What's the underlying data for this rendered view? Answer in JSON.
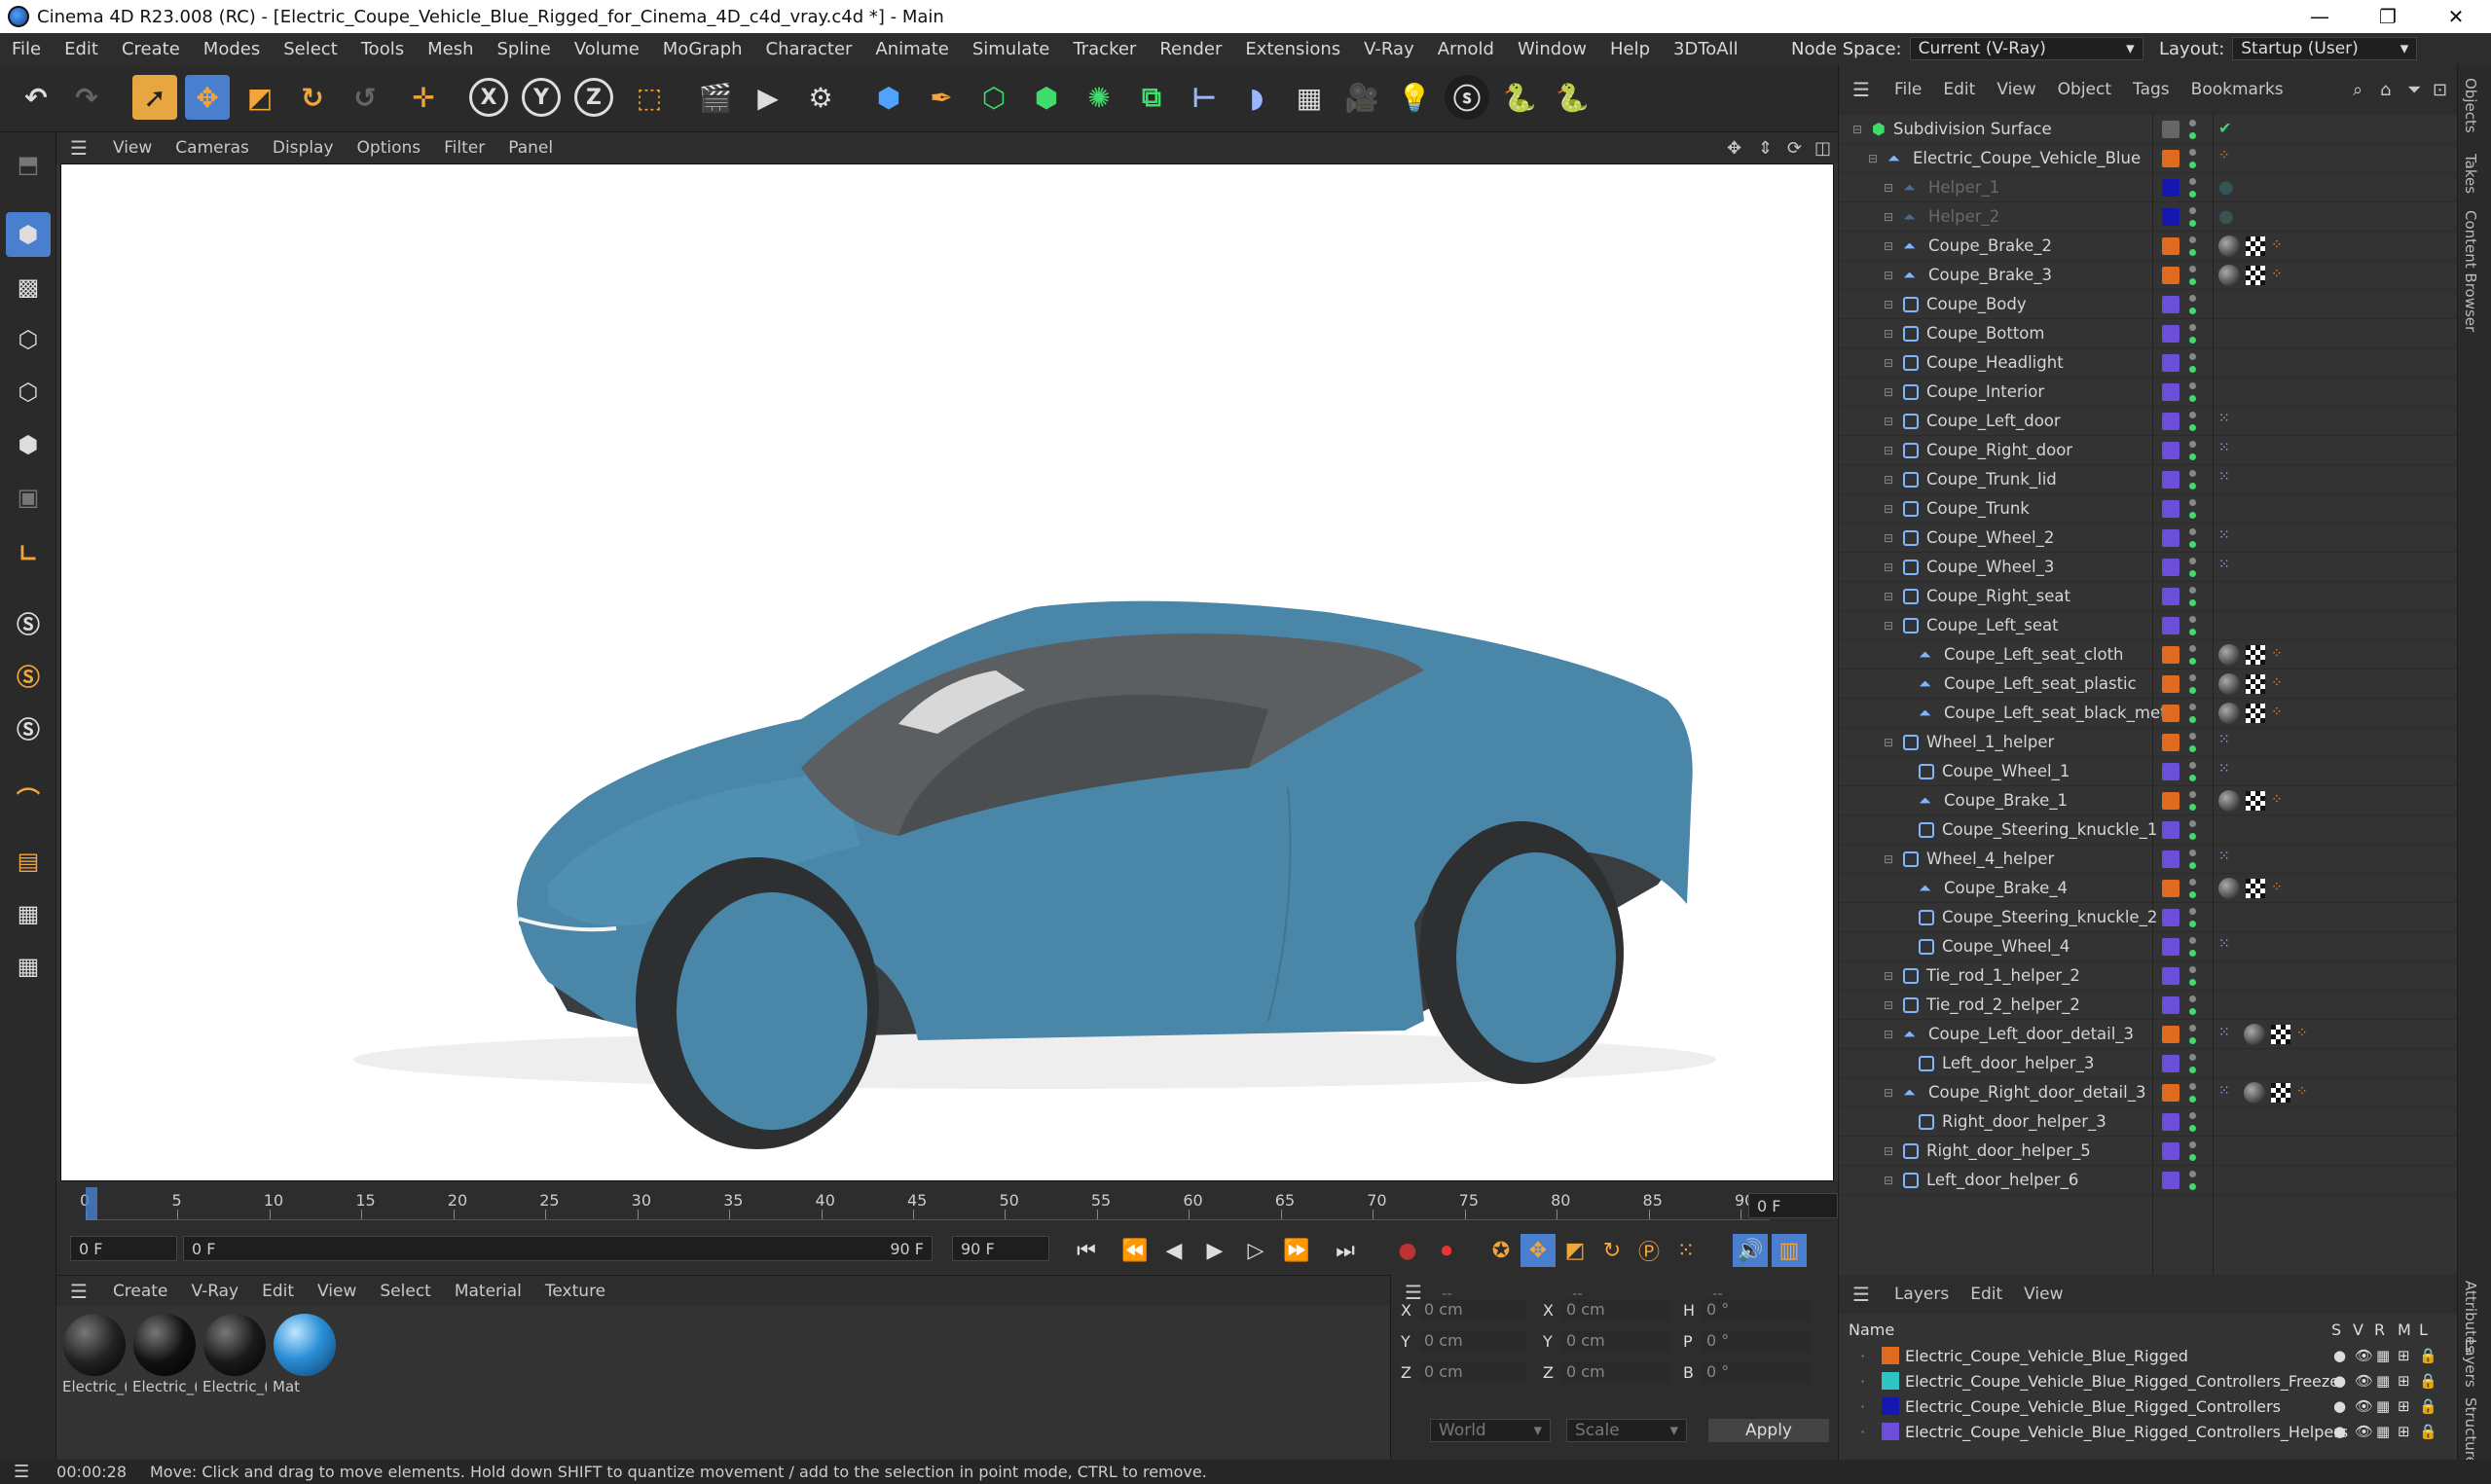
{
  "window": {
    "title": "Cinema 4D R23.008 (RC) - [Electric_Coupe_Vehicle_Blue_Rigged_for_Cinema_4D_c4d_vray.c4d *] - Main",
    "minimize": "—",
    "maximize": "❐",
    "close": "✕"
  },
  "menu": [
    "File",
    "Edit",
    "Create",
    "Modes",
    "Select",
    "Tools",
    "Mesh",
    "Spline",
    "Volume",
    "MoGraph",
    "Character",
    "Animate",
    "Simulate",
    "Tracker",
    "Render",
    "Extensions",
    "V-Ray",
    "Arnold",
    "Window",
    "Help",
    "3DToAll"
  ],
  "node_space": {
    "label": "Node Space:",
    "value": "Current (V-Ray)"
  },
  "layout": {
    "label": "Layout:",
    "value": "Startup (User)"
  },
  "viewport_menu": [
    "View",
    "Cameras",
    "Display",
    "Options",
    "Filter",
    "Panel"
  ],
  "timeline": {
    "ticks": [
      "0",
      "5",
      "10",
      "15",
      "20",
      "25",
      "30",
      "35",
      "40",
      "45",
      "50",
      "55",
      "60",
      "65",
      "70",
      "75",
      "80",
      "85",
      "90"
    ],
    "current_frame": "0 F",
    "start_field": "0 F",
    "range_start": "0 F",
    "range_end": "90 F",
    "end_field": "90 F"
  },
  "material_menu": [
    "Create",
    "V-Ray",
    "Edit",
    "View",
    "Select",
    "Material",
    "Texture"
  ],
  "materials": [
    {
      "label": "Electric_(",
      "color": "#222"
    },
    {
      "label": "Electric_(",
      "color": "#111"
    },
    {
      "label": "Electric_(",
      "color": "#1a1a1a"
    },
    {
      "label": "Mat",
      "color": "#2a8fd6"
    }
  ],
  "coords": {
    "header": "--",
    "header2": "--",
    "header3": "--",
    "rows": [
      {
        "a": "X",
        "av": "0 cm",
        "b": "X",
        "bv": "0 cm",
        "c": "H",
        "cv": "0 °"
      },
      {
        "a": "Y",
        "av": "0 cm",
        "b": "Y",
        "bv": "0 cm",
        "c": "P",
        "cv": "0 °"
      },
      {
        "a": "Z",
        "av": "0 cm",
        "b": "Z",
        "bv": "0 cm",
        "c": "B",
        "cv": "0 °"
      }
    ],
    "world": "World",
    "scale": "Scale",
    "apply": "Apply"
  },
  "objects_menu": [
    "File",
    "Edit",
    "View",
    "Object",
    "Tags",
    "Bookmarks"
  ],
  "objects": [
    {
      "name": "Subdivision Surface",
      "indent": 0,
      "icon": "subdiv",
      "color": "",
      "tags": [
        "check"
      ]
    },
    {
      "name": "Electric_Coupe_Vehicle_Blue",
      "indent": 1,
      "icon": "tri",
      "color": "#e06a1e",
      "tags": [
        "org"
      ]
    },
    {
      "name": "Helper_1",
      "indent": 2,
      "icon": "tri-dim",
      "color": "#1616b0",
      "tags": [
        "dim"
      ]
    },
    {
      "name": "Helper_2",
      "indent": 2,
      "icon": "tri-dim",
      "color": "#1616b0",
      "tags": [
        "dim"
      ]
    },
    {
      "name": "Coupe_Brake_2",
      "indent": 2,
      "icon": "tri",
      "color": "#e06a1e",
      "tags": [
        "ball",
        "chk",
        "org"
      ]
    },
    {
      "name": "Coupe_Brake_3",
      "indent": 2,
      "icon": "tri",
      "color": "#e06a1e",
      "tags": [
        "ball",
        "chk",
        "org"
      ]
    },
    {
      "name": "Coupe_Body",
      "indent": 2,
      "icon": "obj",
      "color": "#6b4fd8",
      "tags": []
    },
    {
      "name": "Coupe_Bottom",
      "indent": 2,
      "icon": "obj",
      "color": "#6b4fd8",
      "tags": []
    },
    {
      "name": "Coupe_Headlight",
      "indent": 2,
      "icon": "obj",
      "color": "#6b4fd8",
      "tags": []
    },
    {
      "name": "Coupe_Interior",
      "indent": 2,
      "icon": "obj",
      "color": "#6b4fd8",
      "tags": []
    },
    {
      "name": "Coupe_Left_door",
      "indent": 2,
      "icon": "obj",
      "color": "#6b4fd8",
      "tags": [
        "xp"
      ]
    },
    {
      "name": "Coupe_Right_door",
      "indent": 2,
      "icon": "obj",
      "color": "#6b4fd8",
      "tags": [
        "xp"
      ]
    },
    {
      "name": "Coupe_Trunk_lid",
      "indent": 2,
      "icon": "obj",
      "color": "#6b4fd8",
      "tags": [
        "xp"
      ]
    },
    {
      "name": "Coupe_Trunk",
      "indent": 2,
      "icon": "obj",
      "color": "#6b4fd8",
      "tags": []
    },
    {
      "name": "Coupe_Wheel_2",
      "indent": 2,
      "icon": "obj",
      "color": "#6b4fd8",
      "tags": [
        "xp"
      ]
    },
    {
      "name": "Coupe_Wheel_3",
      "indent": 2,
      "icon": "obj",
      "color": "#6b4fd8",
      "tags": [
        "xp"
      ]
    },
    {
      "name": "Coupe_Right_seat",
      "indent": 2,
      "icon": "obj",
      "color": "#6b4fd8",
      "tags": []
    },
    {
      "name": "Coupe_Left_seat",
      "indent": 2,
      "icon": "obj",
      "color": "#6b4fd8",
      "tags": []
    },
    {
      "name": "Coupe_Left_seat_cloth",
      "indent": 3,
      "icon": "tri",
      "color": "#e06a1e",
      "tags": [
        "ball",
        "chk",
        "org"
      ]
    },
    {
      "name": "Coupe_Left_seat_plastic",
      "indent": 3,
      "icon": "tri",
      "color": "#e06a1e",
      "tags": [
        "ball",
        "chk",
        "org"
      ]
    },
    {
      "name": "Coupe_Left_seat_black_metal",
      "indent": 3,
      "icon": "tri",
      "color": "#e06a1e",
      "tags": [
        "ball",
        "chk",
        "org"
      ]
    },
    {
      "name": "Wheel_1_helper",
      "indent": 2,
      "icon": "obj",
      "color": "#e06a1e",
      "tags": [
        "xp"
      ]
    },
    {
      "name": "Coupe_Wheel_1",
      "indent": 3,
      "icon": "obj",
      "color": "#6b4fd8",
      "tags": [
        "xp"
      ]
    },
    {
      "name": "Coupe_Brake_1",
      "indent": 3,
      "icon": "tri",
      "color": "#e06a1e",
      "tags": [
        "ball",
        "chk",
        "org"
      ]
    },
    {
      "name": "Coupe_Steering_knuckle_1",
      "indent": 3,
      "icon": "obj",
      "color": "#6b4fd8",
      "tags": []
    },
    {
      "name": "Wheel_4_helper",
      "indent": 2,
      "icon": "obj",
      "color": "#6b4fd8",
      "tags": [
        "xp"
      ]
    },
    {
      "name": "Coupe_Brake_4",
      "indent": 3,
      "icon": "tri",
      "color": "#e06a1e",
      "tags": [
        "ball",
        "chk",
        "org"
      ]
    },
    {
      "name": "Coupe_Steering_knuckle_2",
      "indent": 3,
      "icon": "obj",
      "color": "#6b4fd8",
      "tags": []
    },
    {
      "name": "Coupe_Wheel_4",
      "indent": 3,
      "icon": "obj",
      "color": "#6b4fd8",
      "tags": [
        "xp"
      ]
    },
    {
      "name": "Tie_rod_1_helper_2",
      "indent": 2,
      "icon": "obj",
      "color": "#6b4fd8",
      "tags": []
    },
    {
      "name": "Tie_rod_2_helper_2",
      "indent": 2,
      "icon": "obj",
      "color": "#6b4fd8",
      "tags": []
    },
    {
      "name": "Coupe_Left_door_detail_3",
      "indent": 2,
      "icon": "tri",
      "color": "#e06a1e",
      "tags": [
        "xp",
        "ball",
        "chk",
        "org"
      ]
    },
    {
      "name": "Left_door_helper_3",
      "indent": 3,
      "icon": "obj",
      "color": "#6b4fd8",
      "tags": []
    },
    {
      "name": "Coupe_Right_door_detail_3",
      "indent": 2,
      "icon": "tri",
      "color": "#e06a1e",
      "tags": [
        "xp",
        "ball",
        "chk",
        "org"
      ]
    },
    {
      "name": "Right_door_helper_3",
      "indent": 3,
      "icon": "obj",
      "color": "#6b4fd8",
      "tags": []
    },
    {
      "name": "Right_door_helper_5",
      "indent": 2,
      "icon": "obj",
      "color": "#6b4fd8",
      "tags": []
    },
    {
      "name": "Left_door_helper_6",
      "indent": 2,
      "icon": "obj",
      "color": "#6b4fd8",
      "tags": []
    }
  ],
  "layers_menu": [
    "Layers",
    "Edit",
    "View"
  ],
  "layers_header": {
    "name": "Name",
    "s": "S",
    "v": "V",
    "r": "R",
    "m": "M",
    "l": "L"
  },
  "layers": [
    {
      "name": "Electric_Coupe_Vehicle_Blue_Rigged",
      "color": "#e06a1e"
    },
    {
      "name": "Electric_Coupe_Vehicle_Blue_Rigged_Controllers_Freeze",
      "color": "#2fc4c4"
    },
    {
      "name": "Electric_Coupe_Vehicle_Blue_Rigged_Controllers",
      "color": "#1616b0"
    },
    {
      "name": "Electric_Coupe_Vehicle_Blue_Rigged_Controllers_Helpers",
      "color": "#6b4fd8"
    }
  ],
  "right_tabs": [
    "Objects",
    "Takes",
    "Content Browser",
    "Attributes",
    "Layers",
    "Structure"
  ],
  "status": {
    "time": "00:00:28",
    "message": "Move: Click and drag to move elements. Hold down SHIFT to quantize movement / add to the selection in point mode, CTRL to remove."
  },
  "colors": {
    "car_body": "#4a86a8",
    "accent": "#2a8fd6"
  }
}
